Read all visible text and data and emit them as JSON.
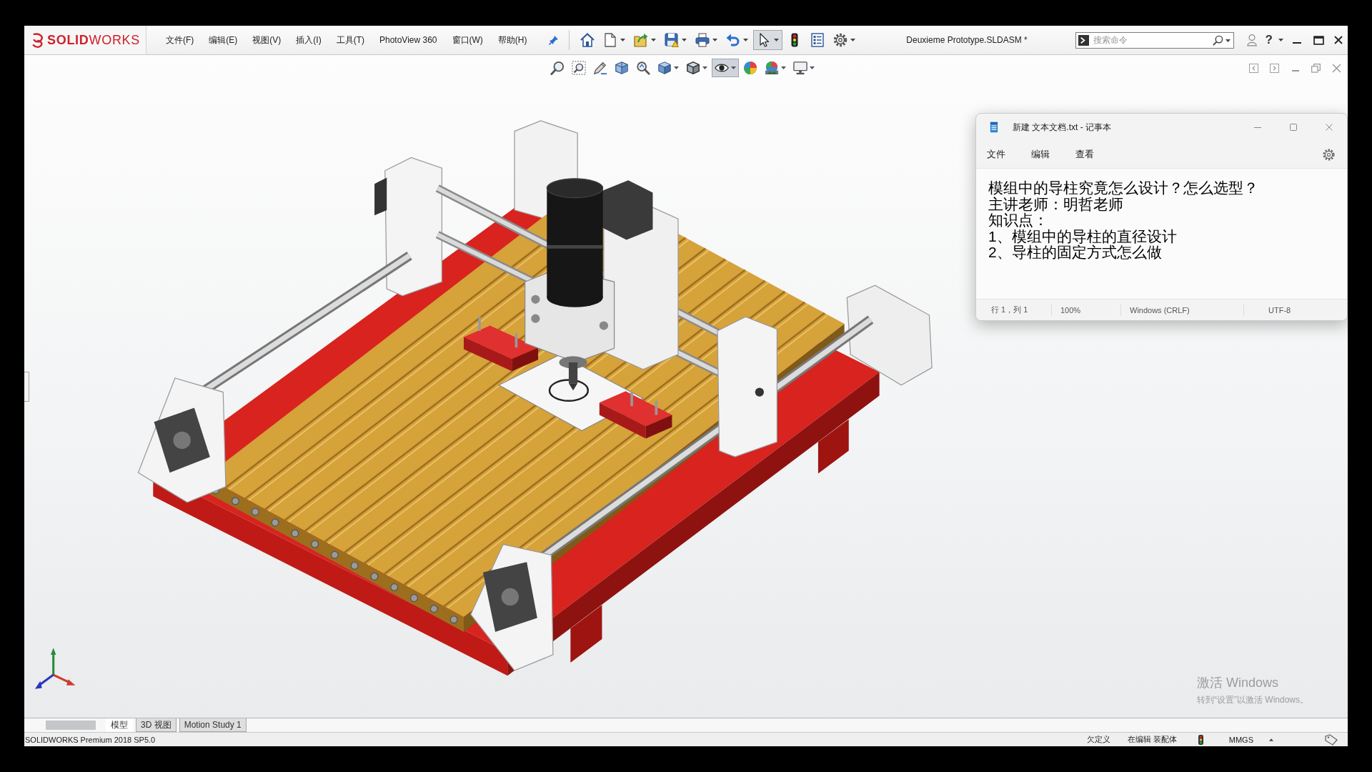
{
  "app_window": {
    "logo": "**SOLID**WORKS",
    "menu": [
      "文件(F)",
      "编辑(E)",
      "视图(V)",
      "插入(I)",
      "工具(T)",
      "PhotoView 360",
      "窗口(W)",
      "帮助(H)"
    ],
    "toolbar": [
      {
        "kind": "home",
        "selected": false,
        "dropdown": false
      },
      {
        "kind": "new",
        "selected": false,
        "dropdown": true
      },
      {
        "kind": "open",
        "selected": false,
        "dropdown": true
      },
      {
        "kind": "save",
        "selected": false,
        "dropdown": true
      },
      {
        "kind": "print",
        "selected": false,
        "dropdown": true
      },
      {
        "kind": "undo",
        "selected": false,
        "dropdown": true
      },
      {
        "kind": "select",
        "selected": true,
        "dropdown": true
      },
      {
        "kind": "rebuild",
        "selected": false,
        "dropdown": false
      },
      {
        "kind": "properties",
        "selected": false,
        "dropdown": false
      },
      {
        "kind": "options",
        "selected": false,
        "dropdown": true
      }
    ],
    "document_title": "Deuxieme Prototype.SLDASM *",
    "search": {
      "placeholder": "搜索命令"
    },
    "help": "?"
  },
  "view_toolbar": [
    {
      "kind": "zoom-fit",
      "selected": false,
      "dropdown": false
    },
    {
      "kind": "zoom-area",
      "selected": false,
      "dropdown": false
    },
    {
      "kind": "previous-view",
      "selected": false,
      "dropdown": false
    },
    {
      "kind": "section-view",
      "selected": false,
      "dropdown": false
    },
    {
      "kind": "annotation",
      "selected": false,
      "dropdown": false
    },
    {
      "kind": "view-orientation",
      "selected": false,
      "dropdown": true
    },
    {
      "kind": "display-style",
      "selected": false,
      "dropdown": true
    },
    {
      "kind": "hide-show",
      "selected": true,
      "dropdown": true
    },
    {
      "kind": "appearance",
      "selected": false,
      "dropdown": false
    },
    {
      "kind": "scene",
      "selected": false,
      "dropdown": true
    },
    {
      "kind": "view-settings",
      "selected": false,
      "dropdown": true
    }
  ],
  "notepad": {
    "title": "新建 文本文档.txt - 记事本",
    "menu": [
      "文件",
      "编辑",
      "查看"
    ],
    "lines": [
      "模组中的导柱究竟怎么设计？怎么选型？",
      "主讲老师：明哲老师",
      "知识点：",
      "1、模组中的导柱的直径设计",
      "2、导柱的固定方式怎么做"
    ],
    "status": [
      "行 1，列 1",
      "100%",
      "Windows (CRLF)",
      "UTF-8"
    ]
  },
  "activation_notice": {
    "title": "激活 Windows",
    "hint": "转到“设置”以激活 Windows。"
  },
  "tabs": [
    {
      "label": "模型",
      "selected": true
    },
    {
      "label": "3D 视图",
      "selected": false
    },
    {
      "label": "Motion Study 1",
      "selected": false
    }
  ],
  "status_bar": {
    "product": "SOLIDWORKS Premium 2018 SP5.0",
    "definition": "欠定义",
    "mode": "在编辑 装配体",
    "units": "MMGS"
  }
}
